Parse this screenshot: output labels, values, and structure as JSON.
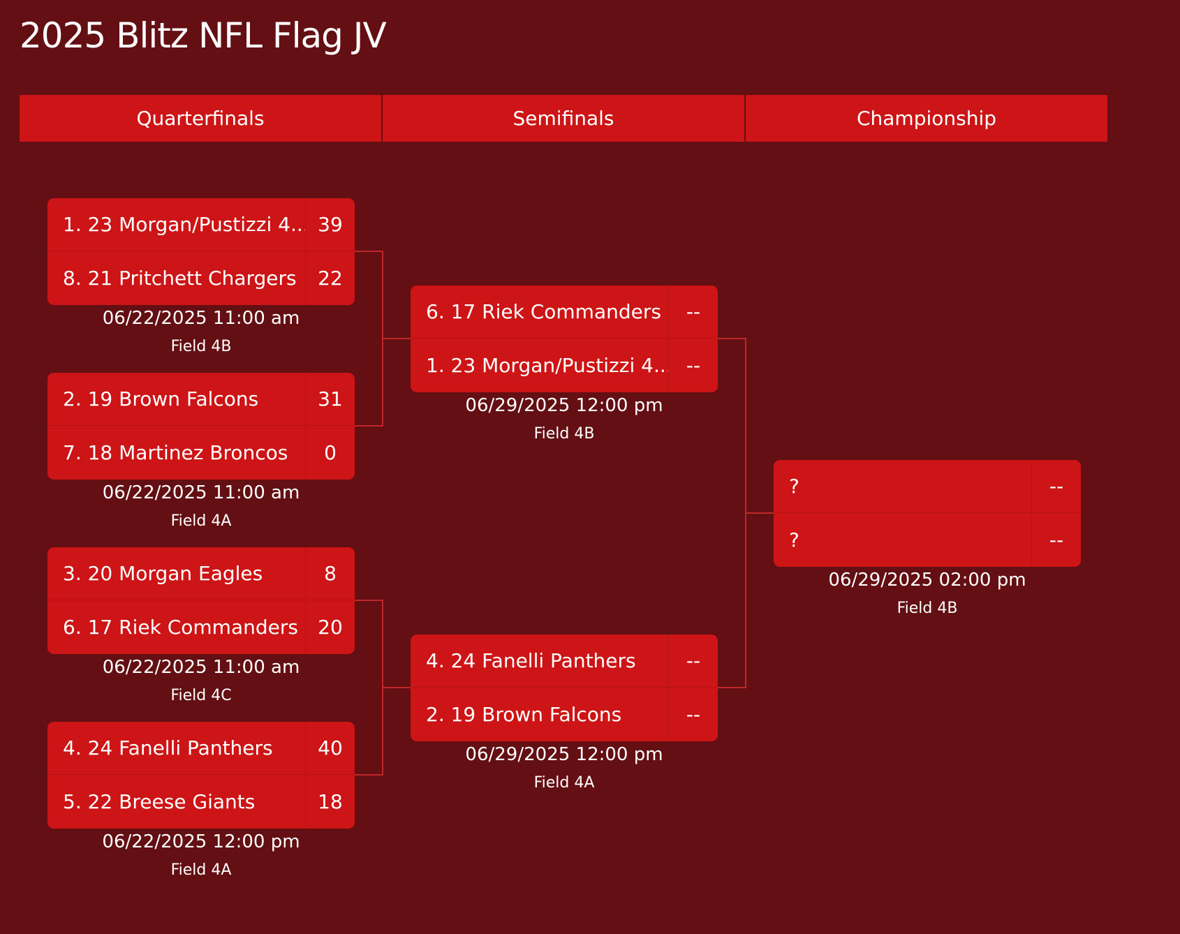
{
  "title": "2025 Blitz NFL Flag JV",
  "rounds": [
    "Quarterfinals",
    "Semifinals",
    "Championship"
  ],
  "quarterfinals": [
    {
      "teams": [
        {
          "name": "1. 23 Morgan/Pustizzi 4...",
          "score": "39"
        },
        {
          "name": "8. 21 Pritchett Chargers",
          "score": "22"
        }
      ],
      "date": "06/22/2025 11:00 am",
      "field": "Field 4B"
    },
    {
      "teams": [
        {
          "name": "2. 19 Brown Falcons",
          "score": "31"
        },
        {
          "name": "7. 18 Martinez Broncos",
          "score": "0"
        }
      ],
      "date": "06/22/2025 11:00 am",
      "field": "Field 4A"
    },
    {
      "teams": [
        {
          "name": "3. 20 Morgan Eagles",
          "score": "8"
        },
        {
          "name": "6. 17 Riek Commanders",
          "score": "20"
        }
      ],
      "date": "06/22/2025 11:00 am",
      "field": "Field 4C"
    },
    {
      "teams": [
        {
          "name": "4. 24 Fanelli Panthers",
          "score": "40"
        },
        {
          "name": "5. 22 Breese Giants",
          "score": "18"
        }
      ],
      "date": "06/22/2025 12:00 pm",
      "field": "Field 4A"
    }
  ],
  "semifinals": [
    {
      "teams": [
        {
          "name": "6. 17 Riek Commanders",
          "score": "--"
        },
        {
          "name": "1. 23 Morgan/Pustizzi 4...",
          "score": "--"
        }
      ],
      "date": "06/29/2025 12:00 pm",
      "field": "Field 4B"
    },
    {
      "teams": [
        {
          "name": "4. 24 Fanelli Panthers",
          "score": "--"
        },
        {
          "name": "2. 19 Brown Falcons",
          "score": "--"
        }
      ],
      "date": "06/29/2025 12:00 pm",
      "field": "Field 4A"
    }
  ],
  "championship": {
    "teams": [
      {
        "name": "?",
        "score": "--"
      },
      {
        "name": "?",
        "score": "--"
      }
    ],
    "date": "06/29/2025 02:00 pm",
    "field": "Field 4B"
  },
  "colors": {
    "background": "#630f13",
    "accent": "#cd1416",
    "connector": "#c0282a",
    "text": "#ffffff"
  }
}
